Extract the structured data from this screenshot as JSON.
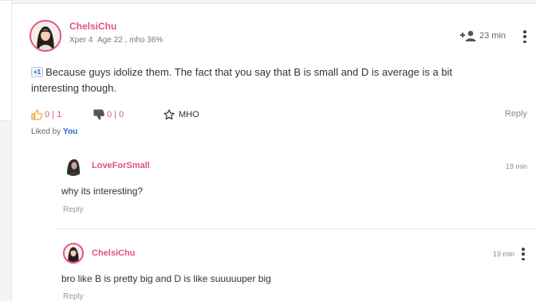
{
  "post": {
    "username": "ChelsiChu",
    "xper": "Xper 4",
    "age": "Age 22",
    "mho": ", mho 36%",
    "time": "23 min",
    "badge": "+1",
    "body": "Because guys idolize them. The fact that you say that B is small and D is average is a bit interesting though.",
    "likes": "0 | 1",
    "dislikes": "0 | 0",
    "mho_label": "MHO",
    "reply_label": "Reply",
    "liked_by_prefix": "Liked by",
    "liked_by_user": "You"
  },
  "replies": [
    {
      "username": "LoveForSmall",
      "time": "19 min",
      "body": "why its interesting?",
      "reply_label": "Reply"
    },
    {
      "username": "ChelsiChu",
      "time": "19 min",
      "body": "bro like B is pretty big and D is like suuuuuper big",
      "reply_label": "Reply"
    }
  ],
  "colors": {
    "accent": "#e0528a",
    "link": "#2b63c4",
    "muted": "#888888",
    "text": "#333333"
  },
  "icons": {
    "follow": "person-plus-icon",
    "more": "kebab-menu-icon",
    "like": "thumb-up-icon",
    "dislike": "thumb-down-icon",
    "mho": "star-icon"
  }
}
